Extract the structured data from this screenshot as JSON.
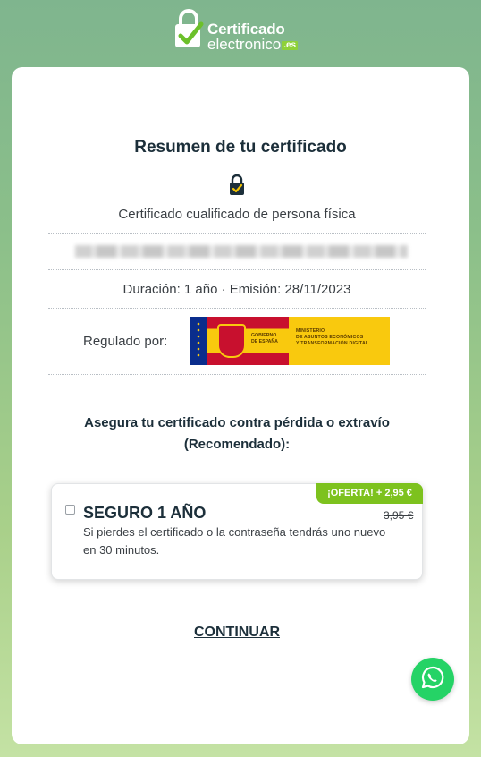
{
  "brand": {
    "line1": "Certificado",
    "line2": "electronico",
    "tld": ".es"
  },
  "summary": {
    "title": "Resumen de tu certificado",
    "cert_type": "Certificado cualificado de persona física",
    "duration": "Duración: 1 año · Emisión: 28/11/2023",
    "regulated_label": "Regulado por:",
    "gov_text_1": "GOBIERNO\nDE ESPAÑA",
    "gov_text_2": "MINISTERIO\nDE ASUNTOS ECONÓMICOS\nY TRANSFORMACIÓN DIGITAL"
  },
  "insurance": {
    "prompt": "Asegura tu certificado contra pérdida o extravío (Recomendado):",
    "badge": "¡OFERTA! + 2,95 €",
    "title": "SEGURO 1 AÑO",
    "old_price": "3,95 €",
    "description": "Si pierdes el certificado o la contraseña tendrás uno nuevo en 30 minutos.",
    "checked": false
  },
  "actions": {
    "continue_label": "CONTINUAR"
  },
  "icons": {
    "brand": "lock-check-icon",
    "shield": "lock-check-icon",
    "chat": "whatsapp-icon"
  },
  "colors": {
    "accent_green": "#7dc21e",
    "text_dark": "#1c2f3a",
    "whatsapp": "#25d366"
  }
}
